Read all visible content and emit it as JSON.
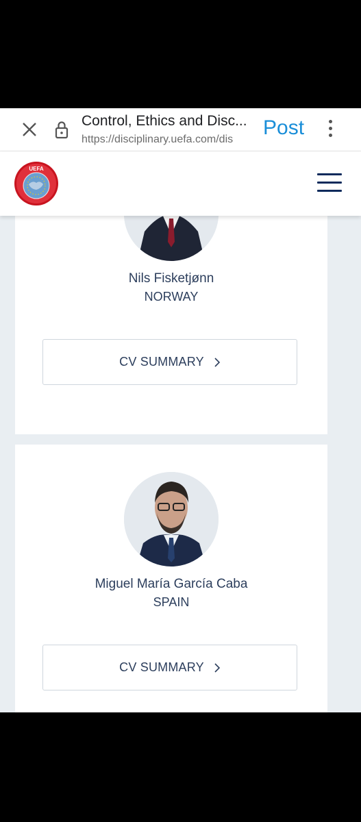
{
  "browser": {
    "title": "Control, Ethics and Disc...",
    "url": "https://disciplinary.uefa.com/dis",
    "post_label": "Post"
  },
  "header": {
    "logo_text": "UEFA",
    "brand_color": "#d81e2c",
    "menu_color": "#0b2a5b"
  },
  "members": [
    {
      "name": "Nils Fisketjønn",
      "country": "NORWAY",
      "cv_label": "CV SUMMARY"
    },
    {
      "name": "Miguel María García Caba",
      "country": "SPAIN",
      "cv_label": "CV SUMMARY"
    }
  ],
  "icons": [
    "close-icon",
    "lock-icon",
    "kebab-menu-icon",
    "uefa-logo",
    "hamburger-menu-icon",
    "chevron-right-icon"
  ]
}
